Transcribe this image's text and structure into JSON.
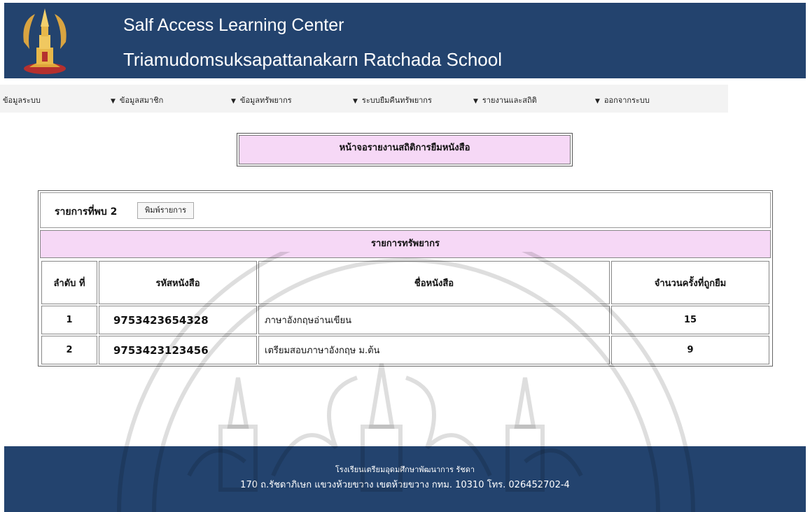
{
  "header": {
    "title": "Salf Access Learning Center",
    "subtitle": "Triamudomsuksapattanakarn Ratchada  School"
  },
  "nav": {
    "items": [
      {
        "label": "ข้อมูลระบบ"
      },
      {
        "label": "ข้อมูลสมาชิก"
      },
      {
        "label": "ข้อมูลทรัพยากร"
      },
      {
        "label": "ระบบยืมคืนทรัพยากร"
      },
      {
        "label": "รายงานและสถิติ"
      },
      {
        "label": "ออกจากระบบ"
      }
    ],
    "arrow": "▼"
  },
  "page_heading": "หน้าจอรายงานสถิติการยืมหนังสือ",
  "report": {
    "found_label": "รายการที่พบ",
    "found_count": "2",
    "print_label": "พิมพ์รายการ",
    "section_title": "รายการทรัพยากร",
    "columns": [
      "ลำดับ ที่",
      "รหัสหนังสือ",
      "ชื่อหนังสือ",
      "จำนวนครั้งที่ถูกยืม"
    ],
    "rows": [
      {
        "no": "1",
        "code": "9753423654328",
        "name": "ภาษาอังกฤษอ่านเขียน",
        "count": "15"
      },
      {
        "no": "2",
        "code": "9753423123456",
        "name": "เตรียมสอบภาษาอังกฤษ ม.ต้น",
        "count": "9"
      }
    ]
  },
  "footer": {
    "line1": "โรงเรียนเตรียมอุดมศึกษาพัฒนาการ รัชดา",
    "line2": "170 ถ.รัชดาภิเษก แขวงห้วยขวาง เขตห้วยขวาง กทม. 10310 โทร. 026452702-4"
  },
  "colors": {
    "header_bg": "#23436e",
    "highlight": "#f6d8f6"
  }
}
